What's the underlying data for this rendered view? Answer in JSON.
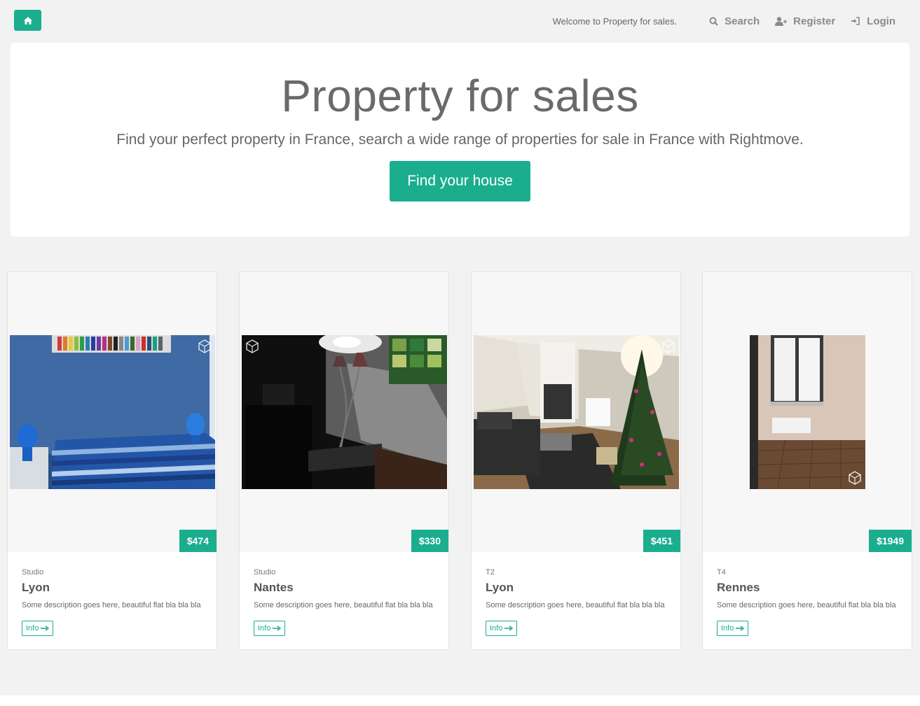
{
  "nav": {
    "home_icon": "home-icon",
    "welcome": "Welcome to Property for sales.",
    "links": [
      {
        "label": "Search",
        "icon": "search-icon"
      },
      {
        "label": "Register",
        "icon": "user-plus-icon"
      },
      {
        "label": "Login",
        "icon": "sign-in-icon"
      }
    ]
  },
  "hero": {
    "title": "Property for sales",
    "subtitle": "Find your perfect property in France, search a wide range of properties for sale in France with Rightmove.",
    "button": "Find your house"
  },
  "listings": [
    {
      "price": "$474",
      "type": "Studio",
      "city": "Lyon",
      "description": "Some description goes here, beautiful flat bla bla bla",
      "info": "Info",
      "photo": "blue bedroom with striped bedspread and blue lamps"
    },
    {
      "price": "$330",
      "type": "Studio",
      "city": "Nantes",
      "description": "Some description goes here, beautiful flat bla bla bla",
      "info": "Info",
      "photo": "dim living room with floor lamp and dresser"
    },
    {
      "price": "$451",
      "type": "T2",
      "city": "Lyon",
      "description": "Some description goes here, beautiful flat bla bla bla",
      "info": "Info",
      "photo": "living room with sofa and christmas tree"
    },
    {
      "price": "$1949",
      "type": "T4",
      "city": "Rennes",
      "description": "Some description goes here, beautiful flat bla bla bla",
      "info": "Info",
      "photo": "empty room with window and tiled floor"
    }
  ],
  "colors": {
    "accent": "#1aae8f",
    "background": "#f2f2f2"
  }
}
